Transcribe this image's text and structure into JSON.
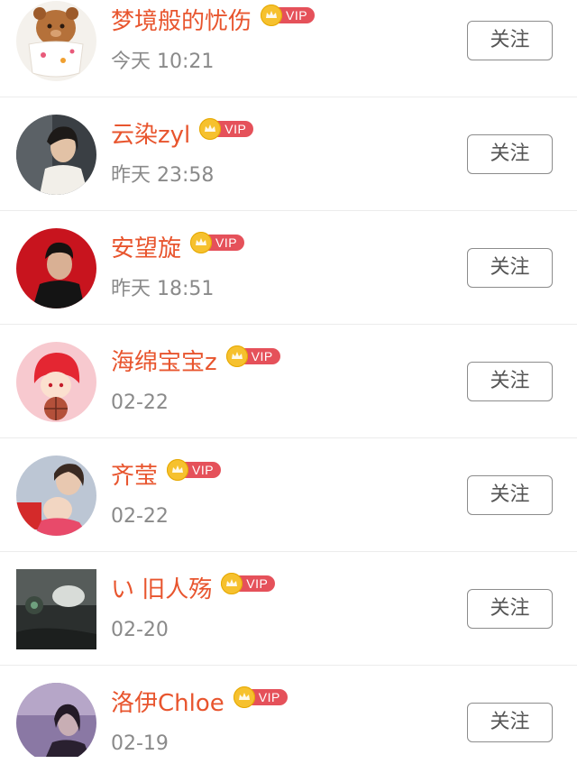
{
  "follow_label": "关注",
  "vip_label": "VIP",
  "colors": {
    "name": "#e8552e",
    "time": "#8a8a8a",
    "vip_badge": "#e5515a",
    "crown": "#f6c12e"
  },
  "users": [
    {
      "name": "梦境般的忧伤",
      "time": "今天 10:21",
      "avatar": "teddy-cup-avatar"
    },
    {
      "name": "云染zyl",
      "time": "昨天 23:58",
      "avatar": "woman-portrait-avatar"
    },
    {
      "name": "安望旋",
      "time": "昨天 18:51",
      "avatar": "man-red-background-avatar"
    },
    {
      "name": "海绵宝宝z",
      "time": "02-22",
      "avatar": "anime-red-hair-avatar"
    },
    {
      "name": "齐莹",
      "time": "02-22",
      "avatar": "mother-baby-avatar"
    },
    {
      "name": "い 旧人殇",
      "time": "02-20",
      "avatar": "dark-art-avatar"
    },
    {
      "name": "洛伊Chloe",
      "time": "02-19",
      "avatar": "purple-portrait-avatar"
    }
  ]
}
